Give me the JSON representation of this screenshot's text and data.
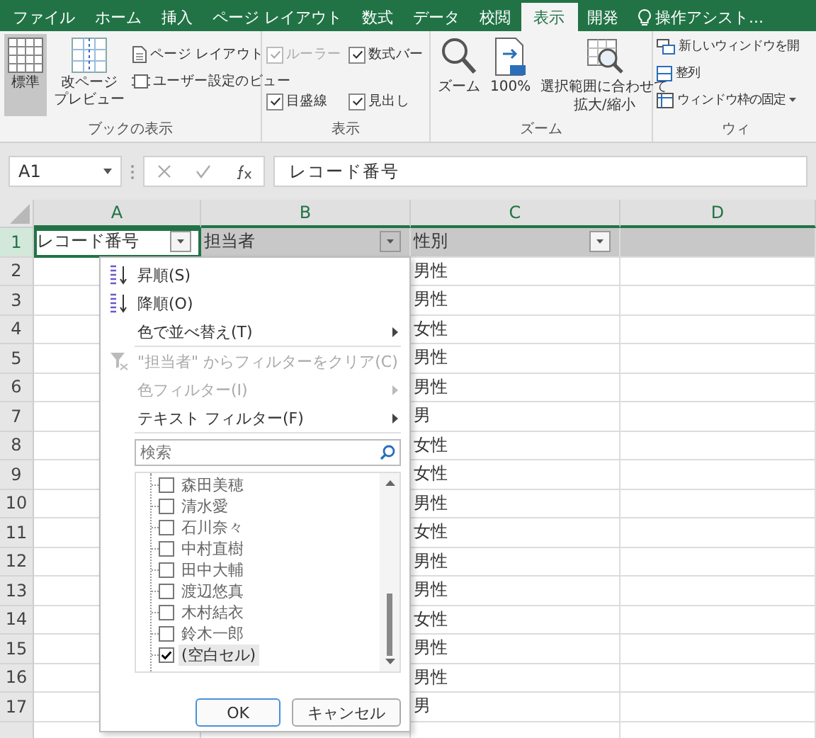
{
  "ribbon_tabs": [
    {
      "label": "ファイル",
      "selected": false
    },
    {
      "label": "ホーム",
      "selected": false
    },
    {
      "label": "挿入",
      "selected": false
    },
    {
      "label": "ページ レイアウト",
      "selected": false
    },
    {
      "label": "数式",
      "selected": false
    },
    {
      "label": "データ",
      "selected": false
    },
    {
      "label": "校閲",
      "selected": false
    },
    {
      "label": "表示",
      "selected": true
    },
    {
      "label": "開発",
      "selected": false
    }
  ],
  "tell_me": "操作アシスト...",
  "groups": [
    {
      "label": "ブックの表示"
    },
    {
      "label": "表示"
    },
    {
      "label": "ズーム"
    },
    {
      "label": "ウィ"
    }
  ],
  "workbook_views": {
    "normal": {
      "label": "標準",
      "selected": true
    },
    "page_break": {
      "lines": [
        "改ページ",
        "プレビュー"
      ],
      "selected": false
    },
    "page_layout": "ページ レイアウト",
    "custom_views": "ユーザー設定のビュー"
  },
  "show_options": [
    {
      "label": "ルーラー",
      "checked": true,
      "disabled": true
    },
    {
      "label": "数式バー",
      "checked": true,
      "disabled": false
    },
    {
      "label": "目盛線",
      "checked": true,
      "disabled": false
    },
    {
      "label": "見出し",
      "checked": true,
      "disabled": false
    }
  ],
  "zoom_buttons": [
    {
      "kind": "zoom",
      "lines": [
        "ズーム"
      ]
    },
    {
      "kind": "hundred",
      "lines": [
        "100%"
      ]
    },
    {
      "kind": "selection",
      "lines": [
        "選択範囲に合わせて",
        "拡大/縮小"
      ]
    }
  ],
  "window_buttons": [
    "新しいウィンドウを開",
    "整列",
    "ウィンドウ枠の固定"
  ],
  "name_box": "A1",
  "formula": "レコード番号",
  "columns": [
    "A",
    "B",
    "C",
    "D"
  ],
  "header_row": {
    "number": "1",
    "cells": [
      "レコード番号",
      "担当者",
      "性別"
    ]
  },
  "rows": [
    {
      "number": "2",
      "gender": "男性"
    },
    {
      "number": "3",
      "gender": "男性"
    },
    {
      "number": "4",
      "gender": "女性"
    },
    {
      "number": "5",
      "gender": "男性"
    },
    {
      "number": "6",
      "gender": "男性"
    },
    {
      "number": "7",
      "gender": "男"
    },
    {
      "number": "8",
      "gender": "女性"
    },
    {
      "number": "9",
      "gender": "女性"
    },
    {
      "number": "10",
      "gender": "男性"
    },
    {
      "number": "11",
      "gender": "女性"
    },
    {
      "number": "12",
      "gender": "男性"
    },
    {
      "number": "13",
      "gender": "男性"
    },
    {
      "number": "14",
      "gender": "女性"
    },
    {
      "number": "15",
      "gender": "男性"
    },
    {
      "number": "16",
      "gender": "男性"
    },
    {
      "number": "17",
      "gender": "男"
    }
  ],
  "filter_menu": {
    "commands": [
      {
        "kind": "sort_asc",
        "label": "昇順(S)",
        "disabled": false,
        "submenu": false
      },
      {
        "kind": "sort_desc",
        "label": "降順(O)",
        "disabled": false,
        "submenu": false
      },
      {
        "kind": "plain",
        "label": "色で並べ替え(T)",
        "disabled": false,
        "submenu": true
      },
      {
        "kind": "clear",
        "label": "\"担当者\" からフィルターをクリア(C)",
        "disabled": true,
        "submenu": false
      },
      {
        "kind": "plain",
        "label": "色フィルター(I)",
        "disabled": true,
        "submenu": true
      },
      {
        "kind": "plain",
        "label": "テキスト フィルター(F)",
        "disabled": false,
        "submenu": true
      }
    ],
    "search_placeholder": "検索",
    "values": [
      {
        "label": "森田美穂",
        "checked": false
      },
      {
        "label": "清水愛",
        "checked": false
      },
      {
        "label": "石川奈々",
        "checked": false
      },
      {
        "label": "中村直樹",
        "checked": false
      },
      {
        "label": "田中大輔",
        "checked": false
      },
      {
        "label": "渡辺悠真",
        "checked": false
      },
      {
        "label": "木村結衣",
        "checked": false
      },
      {
        "label": "鈴木一郎",
        "checked": false
      },
      {
        "label": "(空白セル)",
        "checked": true
      }
    ],
    "buttons": [
      "OK",
      "キャンセル"
    ]
  }
}
